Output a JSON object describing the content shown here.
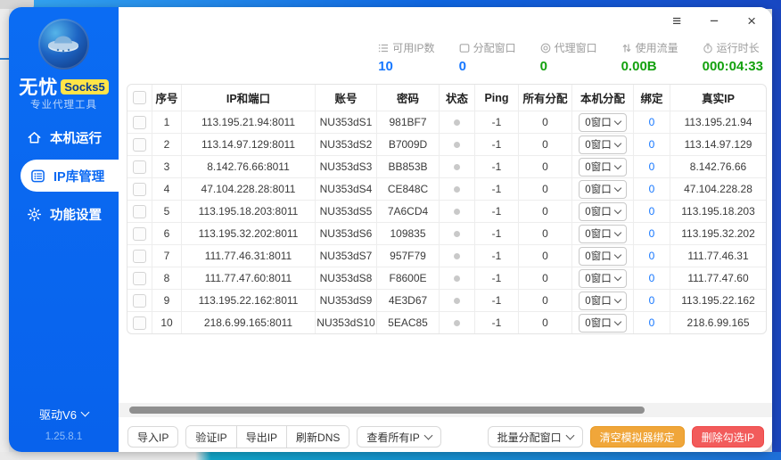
{
  "window_controls": {
    "menu_icon": "≡",
    "minimize_icon": "−",
    "close_icon": "×"
  },
  "sidebar": {
    "brand_name": "无忧",
    "brand_badge": "Socks5",
    "brand_subtitle": "专业代理工具",
    "nav": [
      {
        "label": "本机运行",
        "icon": "home-icon",
        "active": false
      },
      {
        "label": "IP库管理",
        "icon": "ip-library-icon",
        "active": true
      },
      {
        "label": "功能设置",
        "icon": "gear-icon",
        "active": false
      }
    ],
    "driver_label": "驱动V6",
    "version": "1.25.8.1"
  },
  "stats": [
    {
      "label": "可用IP数",
      "value": "10",
      "color": "#1677ff",
      "icon": "list-icon"
    },
    {
      "label": "分配窗口",
      "value": "0",
      "color": "#1677ff",
      "icon": "window-icon"
    },
    {
      "label": "代理窗口",
      "value": "0",
      "color": "#13a10e",
      "icon": "proxy-window-icon"
    },
    {
      "label": "使用流量",
      "value": "0.00B",
      "color": "#13a10e",
      "icon": "traffic-icon"
    },
    {
      "label": "运行时长",
      "value": "000:04:33",
      "color": "#13a10e",
      "icon": "timer-icon"
    }
  ],
  "table": {
    "headers": [
      "序号",
      "IP和端口",
      "账号",
      "密码",
      "状态",
      "Ping",
      "所有分配",
      "本机分配",
      "绑定",
      "真实IP"
    ],
    "rows": [
      {
        "idx": "1",
        "ip_port": "113.195.21.94:8011",
        "account": "NU353dS1",
        "password": "981BF7",
        "ping": "-1",
        "all_assign": "0",
        "local_assign": "0窗口",
        "bind": "0",
        "real_ip": "113.195.21.94"
      },
      {
        "idx": "2",
        "ip_port": "113.14.97.129:8011",
        "account": "NU353dS2",
        "password": "B7009D",
        "ping": "-1",
        "all_assign": "0",
        "local_assign": "0窗口",
        "bind": "0",
        "real_ip": "113.14.97.129"
      },
      {
        "idx": "3",
        "ip_port": "8.142.76.66:8011",
        "account": "NU353dS3",
        "password": "BB853B",
        "ping": "-1",
        "all_assign": "0",
        "local_assign": "0窗口",
        "bind": "0",
        "real_ip": "8.142.76.66"
      },
      {
        "idx": "4",
        "ip_port": "47.104.228.28:8011",
        "account": "NU353dS4",
        "password": "CE848C",
        "ping": "-1",
        "all_assign": "0",
        "local_assign": "0窗口",
        "bind": "0",
        "real_ip": "47.104.228.28"
      },
      {
        "idx": "5",
        "ip_port": "113.195.18.203:8011",
        "account": "NU353dS5",
        "password": "7A6CD4",
        "ping": "-1",
        "all_assign": "0",
        "local_assign": "0窗口",
        "bind": "0",
        "real_ip": "113.195.18.203"
      },
      {
        "idx": "6",
        "ip_port": "113.195.32.202:8011",
        "account": "NU353dS6",
        "password": "109835",
        "ping": "-1",
        "all_assign": "0",
        "local_assign": "0窗口",
        "bind": "0",
        "real_ip": "113.195.32.202"
      },
      {
        "idx": "7",
        "ip_port": "111.77.46.31:8011",
        "account": "NU353dS7",
        "password": "957F79",
        "ping": "-1",
        "all_assign": "0",
        "local_assign": "0窗口",
        "bind": "0",
        "real_ip": "111.77.46.31"
      },
      {
        "idx": "8",
        "ip_port": "111.77.47.60:8011",
        "account": "NU353dS8",
        "password": "F8600E",
        "ping": "-1",
        "all_assign": "0",
        "local_assign": "0窗口",
        "bind": "0",
        "real_ip": "111.77.47.60"
      },
      {
        "idx": "9",
        "ip_port": "113.195.22.162:8011",
        "account": "NU353dS9",
        "password": "4E3D67",
        "ping": "-1",
        "all_assign": "0",
        "local_assign": "0窗口",
        "bind": "0",
        "real_ip": "113.195.22.162"
      },
      {
        "idx": "10",
        "ip_port": "218.6.99.165:8011",
        "account": "NU353dS10",
        "password": "5EAC85",
        "ping": "-1",
        "all_assign": "0",
        "local_assign": "0窗口",
        "bind": "0",
        "real_ip": "218.6.99.165"
      }
    ]
  },
  "toolbar": {
    "import_ip": "导入IP",
    "verify_ip": "验证IP",
    "export_ip": "导出IP",
    "refresh_dns": "刷新DNS",
    "view_all_ip": "查看所有IP",
    "batch_assign_window": "批量分配窗口",
    "clear_emulator_binding": "清空模拟器绑定",
    "delete_checked_ip": "删除勾选IP"
  },
  "colors": {
    "sidebar_blue": "#0a68f2",
    "accent_blue": "#1677ff",
    "green": "#13a10e",
    "badge_yellow": "#ffe448",
    "orange_button": "#f0a63a",
    "red_button": "#f25b5b"
  }
}
